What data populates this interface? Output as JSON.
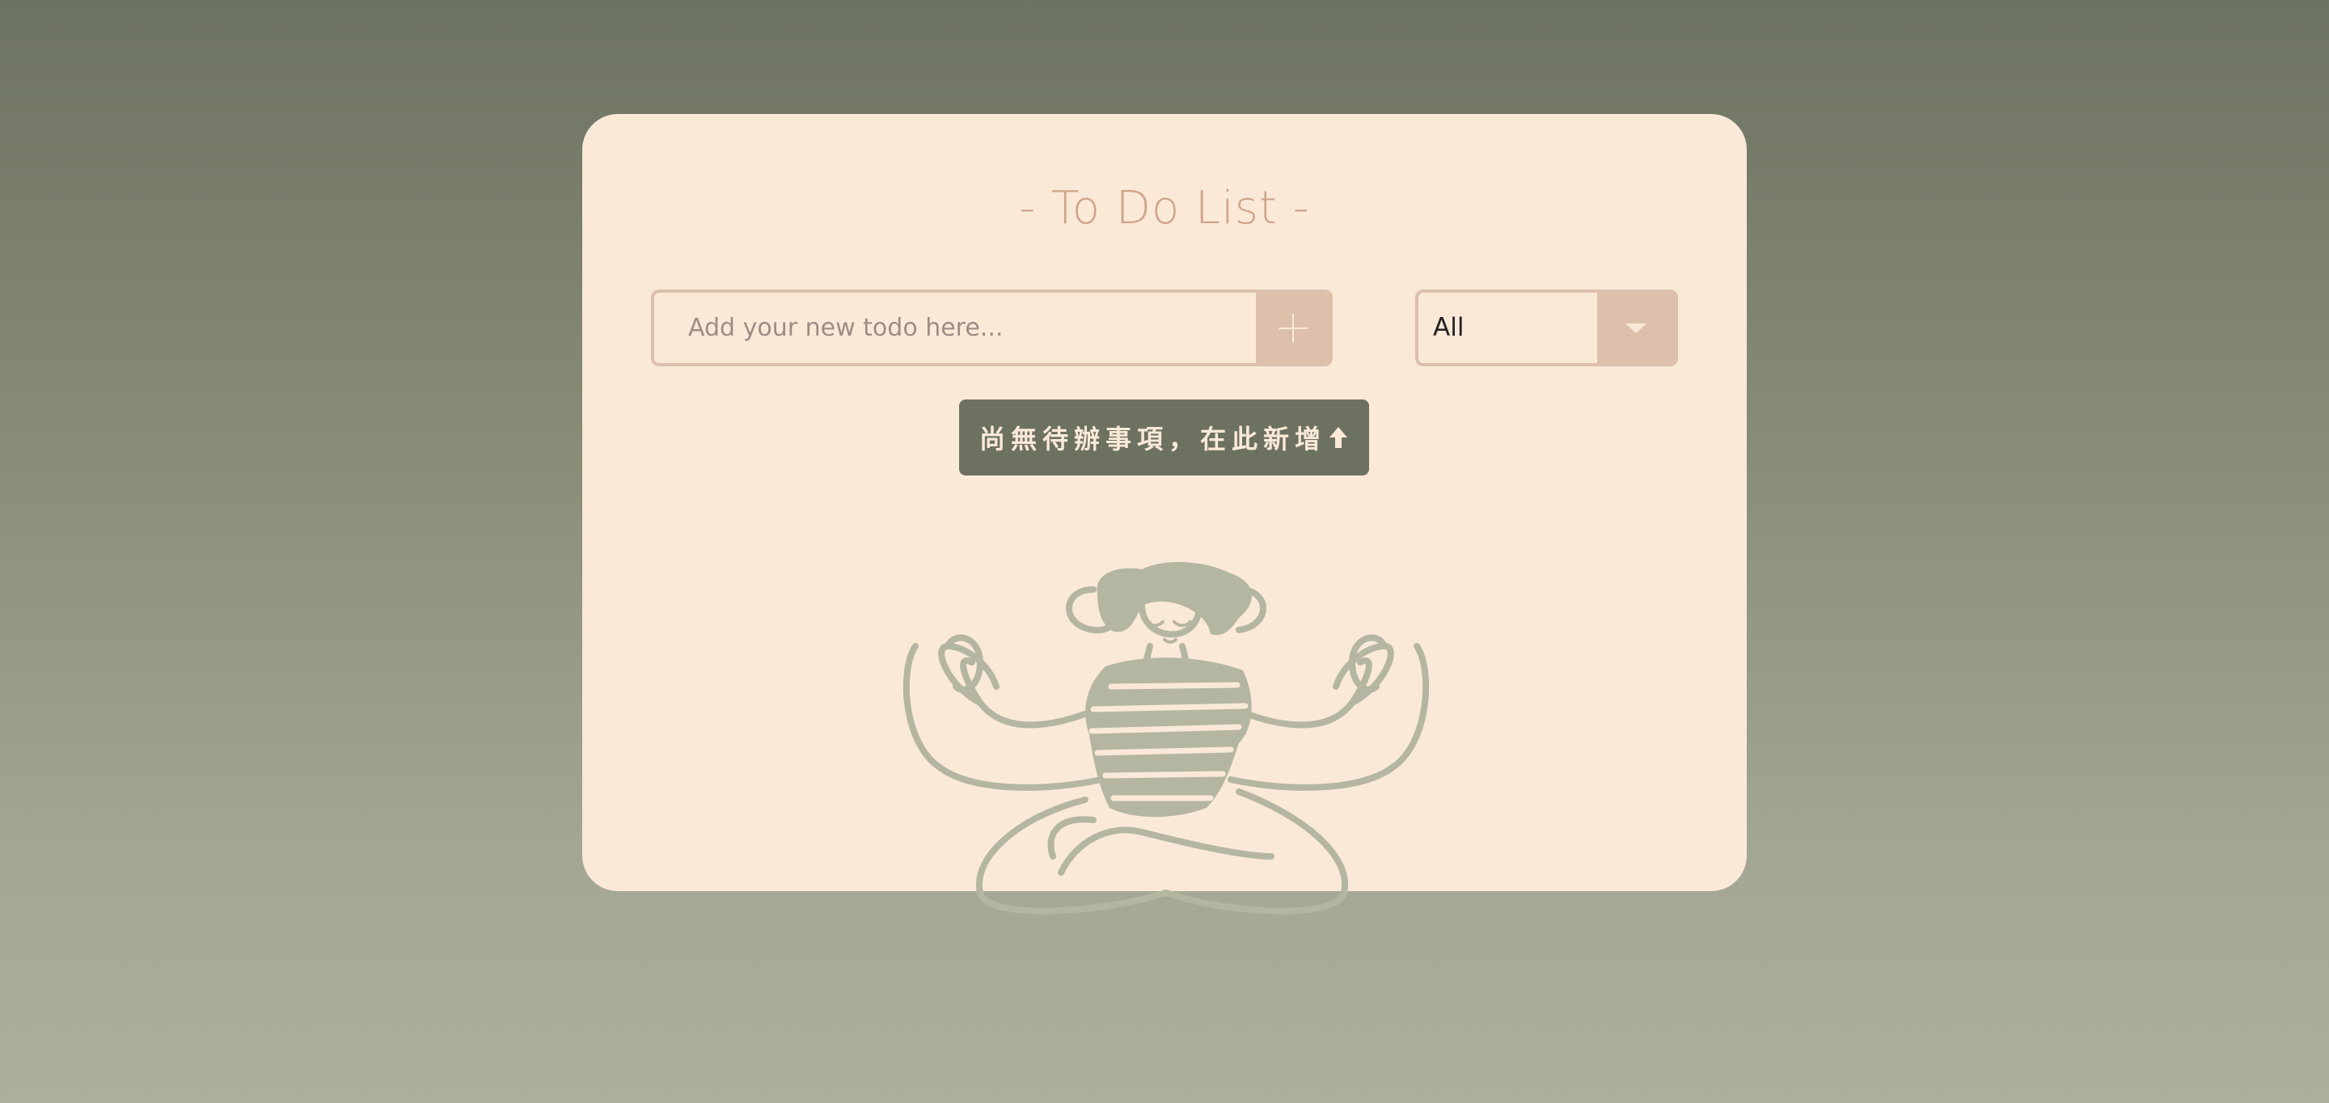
{
  "title": "- To Do List -",
  "new_todo": {
    "placeholder": "Add your new todo here...",
    "value": "",
    "add_icon": "plus-icon"
  },
  "filter": {
    "selected": "All",
    "arrow_icon": "caret-down-icon"
  },
  "empty_state": {
    "message": "尚無待辦事項，在此新增",
    "icon": "arrow-up-icon",
    "illustration": "meditating-person"
  },
  "colors": {
    "card_bg": "#fbe9d8",
    "accent": "#dcc0ac",
    "title": "#cfa38a",
    "badge_bg": "#6d7260",
    "illustration": "#b4b6a2"
  }
}
